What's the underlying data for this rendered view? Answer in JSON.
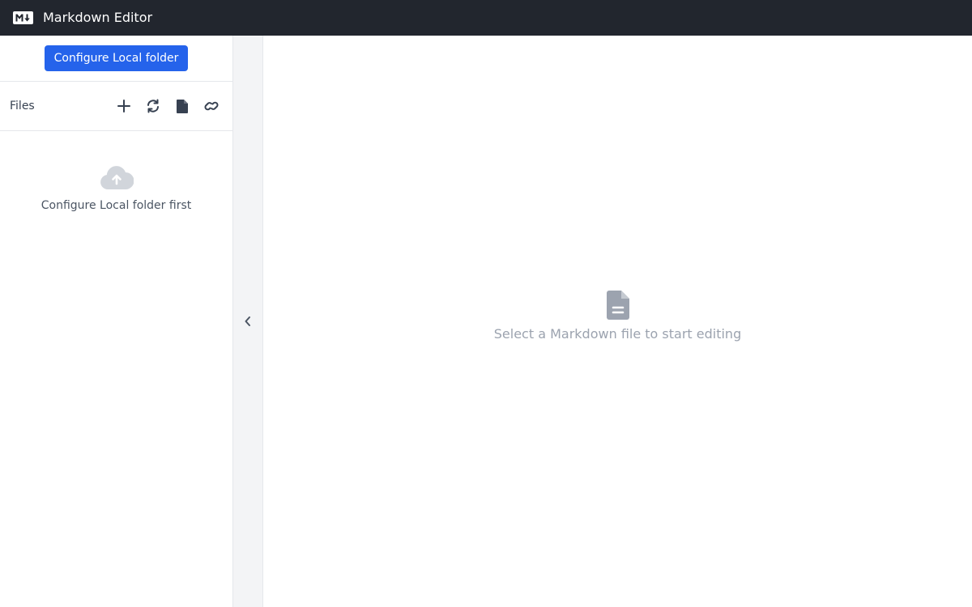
{
  "app": {
    "title": "Markdown Editor",
    "logo_icon": "markdown-logo-icon",
    "header_bg": "#22262e"
  },
  "sidebar": {
    "configure_button_label": "Configure Local folder",
    "files_label": "Files",
    "actions": [
      {
        "name": "new-file",
        "icon": "plus-icon"
      },
      {
        "name": "refresh",
        "icon": "sync-icon"
      },
      {
        "name": "document",
        "icon": "file-icon"
      },
      {
        "name": "link",
        "icon": "link-icon"
      }
    ],
    "empty_state": {
      "icon": "cloud-upload-icon",
      "text": "Configure Local folder first"
    }
  },
  "collapse": {
    "icon": "chevron-left-icon"
  },
  "main": {
    "placeholder_icon": "file-text-icon",
    "placeholder_text": "Select a Markdown file to start editing"
  },
  "colors": {
    "accent": "#2563eb",
    "muted_icon": "#9ca3af",
    "dark_icon": "#374151"
  }
}
